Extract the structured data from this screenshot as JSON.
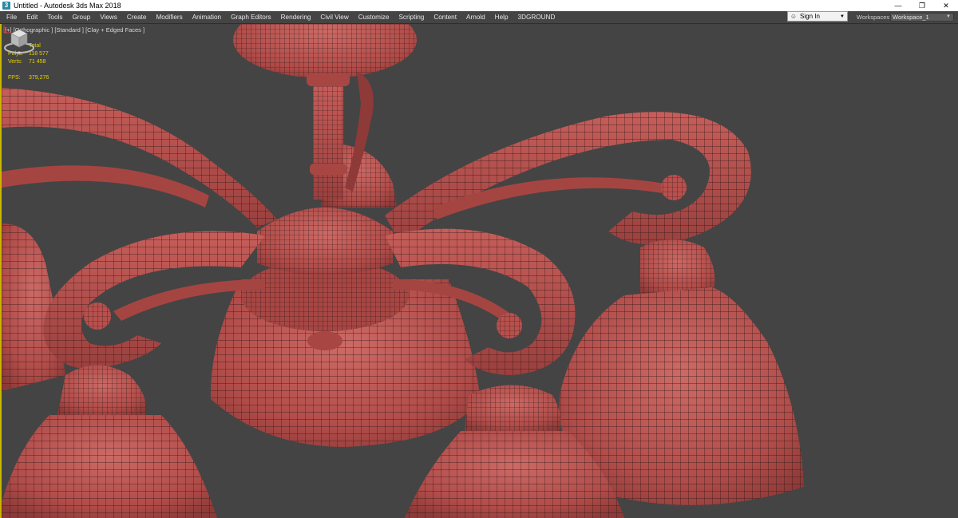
{
  "window": {
    "title": "Untitled - Autodesk 3ds Max 2018",
    "app_icon_glyph": "3",
    "controls": [
      "—",
      "❐",
      "✕"
    ]
  },
  "menu": {
    "items": [
      "File",
      "Edit",
      "Tools",
      "Group",
      "Views",
      "Create",
      "Modifiers",
      "Animation",
      "Graph Editors",
      "Rendering",
      "Civil View",
      "Customize",
      "Scripting",
      "Content",
      "Arnold",
      "Help",
      "3DGROUND"
    ]
  },
  "account": {
    "sign_in_label": "Sign In",
    "icon": "user-icon"
  },
  "workspace": {
    "label": "Workspaces:",
    "selected": "Workspace_1"
  },
  "viewport": {
    "label": "[+] [Orthographic ] [Standard ] [Clay + Edged Faces ]",
    "stats": {
      "header": "Total",
      "polys_label": "Polys:",
      "polys_value": "118 577",
      "verts_label": "Verts:",
      "verts_value": "71 458",
      "fps_label": "FPS:",
      "fps_value": "379,276"
    }
  },
  "colors": {
    "viewport_bg": "#444444",
    "clay": "#b8504d",
    "wire": "#2a1515",
    "stats_text": "#e6d200",
    "active_border": "#c8b600"
  }
}
